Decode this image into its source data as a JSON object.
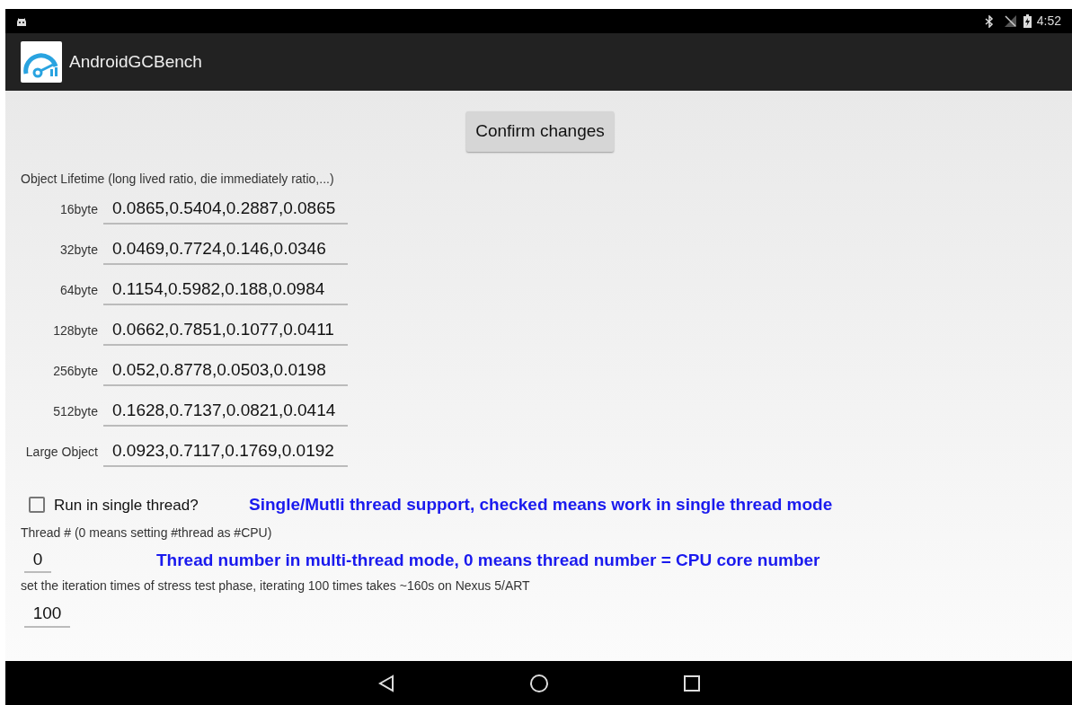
{
  "status_bar": {
    "time": "4:52"
  },
  "app_bar": {
    "title": "AndroidGCBench"
  },
  "confirm_button": "Confirm changes",
  "lifetime": {
    "heading": "Object Lifetime (long lived ratio, die immediately ratio,...)",
    "rows": [
      {
        "label": "16byte",
        "value": "0.0865,0.5404,0.2887,0.0865"
      },
      {
        "label": "32byte",
        "value": "0.0469,0.7724,0.146,0.0346"
      },
      {
        "label": "64byte",
        "value": "0.1154,0.5982,0.188,0.0984"
      },
      {
        "label": "128byte",
        "value": "0.0662,0.7851,0.1077,0.0411"
      },
      {
        "label": "256byte",
        "value": "0.052,0.8778,0.0503,0.0198"
      },
      {
        "label": "512byte",
        "value": "0.1628,0.7137,0.0821,0.0414"
      },
      {
        "label": "Large Object",
        "value": "0.0923,0.7117,0.1769,0.0192"
      }
    ]
  },
  "single_thread": {
    "label": "Run in single thread?",
    "checked": false,
    "note": "Single/Mutli thread support, checked means work in single thread mode"
  },
  "thread_count": {
    "label": "Thread # (0 means setting #thread as #CPU)",
    "value": "0",
    "note": "Thread number in multi-thread mode, 0 means thread number = CPU core number"
  },
  "iterations": {
    "label": "set the iteration times of stress test phase, iterating 100 times takes ~160s on Nexus 5/ART",
    "value": "100"
  }
}
